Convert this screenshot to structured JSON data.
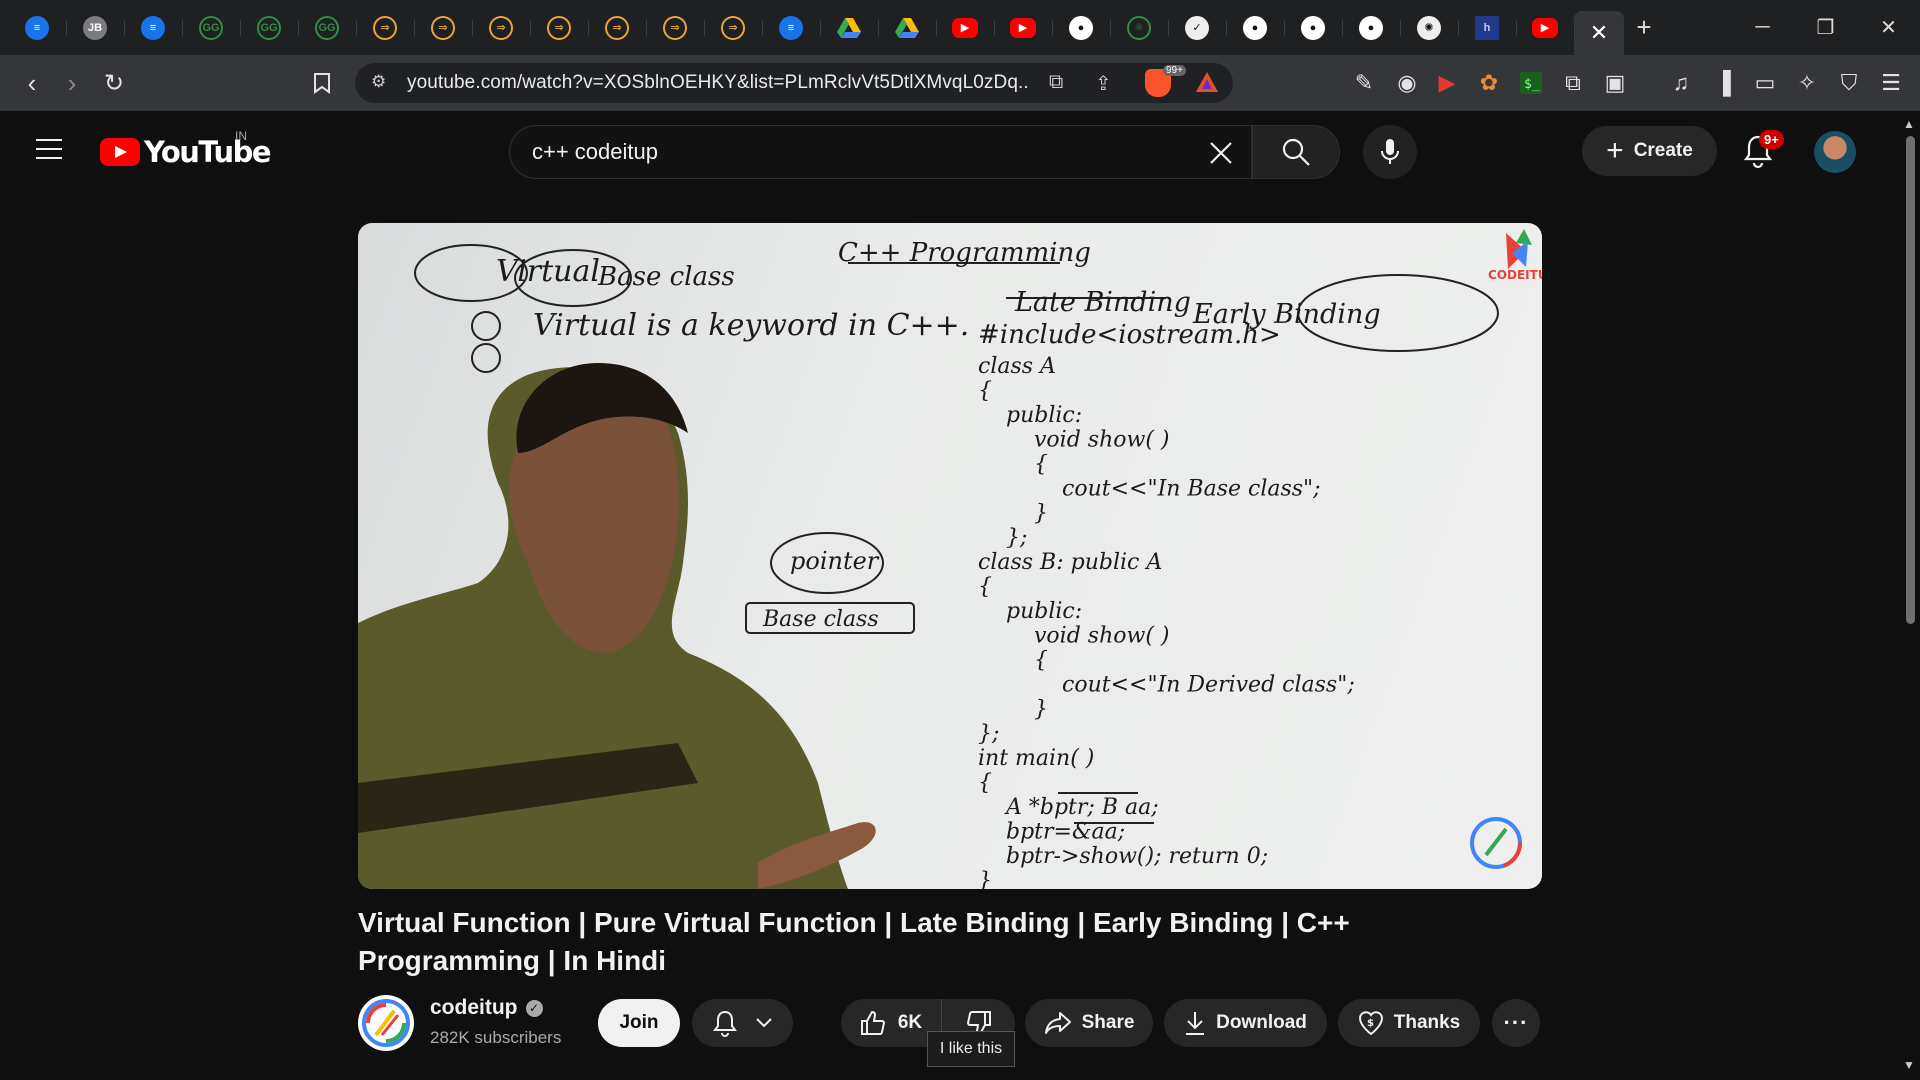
{
  "browser": {
    "tabs": [
      {
        "icon": "docs-icon"
      },
      {
        "icon": "jetbrains-icon"
      },
      {
        "icon": "docs-icon"
      },
      {
        "icon": "geeksforgeeks-icon"
      },
      {
        "icon": "geeksforgeeks-icon"
      },
      {
        "icon": "geeksforgeeks-icon"
      },
      {
        "icon": "signal-icon"
      },
      {
        "icon": "signal-icon"
      },
      {
        "icon": "signal-icon"
      },
      {
        "icon": "signal-icon"
      },
      {
        "icon": "signal-icon"
      },
      {
        "icon": "signal-icon"
      },
      {
        "icon": "signal-icon"
      },
      {
        "icon": "docs-icon"
      },
      {
        "icon": "drive-icon"
      },
      {
        "icon": "drive-icon"
      },
      {
        "icon": "youtube-icon"
      },
      {
        "icon": "youtube-icon"
      },
      {
        "icon": "github-icon"
      },
      {
        "icon": "react-icon"
      },
      {
        "icon": "shield-icon"
      },
      {
        "icon": "github-icon"
      },
      {
        "icon": "github-icon"
      },
      {
        "icon": "github-icon"
      },
      {
        "icon": "openai-icon"
      },
      {
        "icon": "hashnode-icon"
      },
      {
        "icon": "youtube-icon"
      }
    ],
    "url": "youtube.com/watch?v=XOSblnOEHKY&list=PLmRclvVt5DtlXMvqL0zDq...",
    "brave_badge": "99+"
  },
  "youtube": {
    "logo_text": "YouTube",
    "country": "IN",
    "search_query": "c++ codeitup",
    "create_label": "Create",
    "notification_count": "9+"
  },
  "video": {
    "title": "Virtual Function | Pure Virtual Function | Late Binding | Early Binding | C++ Programming | In Hindi",
    "whiteboard": {
      "heading": "C++ Programming",
      "topic_left_1": "Virtual",
      "topic_left_2": "Base class",
      "note_line": "Virtual is a keyword in C++.",
      "late_binding": "Late Binding",
      "early_binding": "Early Binding",
      "code": [
        "#include<iostream.h>",
        "class A",
        "{",
        "public:",
        "void show( )",
        "{",
        "cout<<\"In Base class\";",
        "}",
        "};",
        "class B: public A",
        "{",
        "public:",
        "void show( )",
        "{",
        "cout<<\"In Derived class\";",
        "}",
        "};",
        "int main( )",
        "{",
        "A *bptr; B aa;",
        "bptr=&aa;",
        "bptr->show(); return 0;",
        "}"
      ],
      "pointer_label": "pointer",
      "base_class_label": "Base class",
      "watermark": "CODEITUP"
    }
  },
  "channel": {
    "name": "codeitup",
    "subscribers": "282K subscribers",
    "join_label": "Join"
  },
  "actions": {
    "like_count": "6K",
    "share_label": "Share",
    "download_label": "Download",
    "thanks_label": "Thanks",
    "more_label": "···",
    "tooltip": "I like this"
  }
}
